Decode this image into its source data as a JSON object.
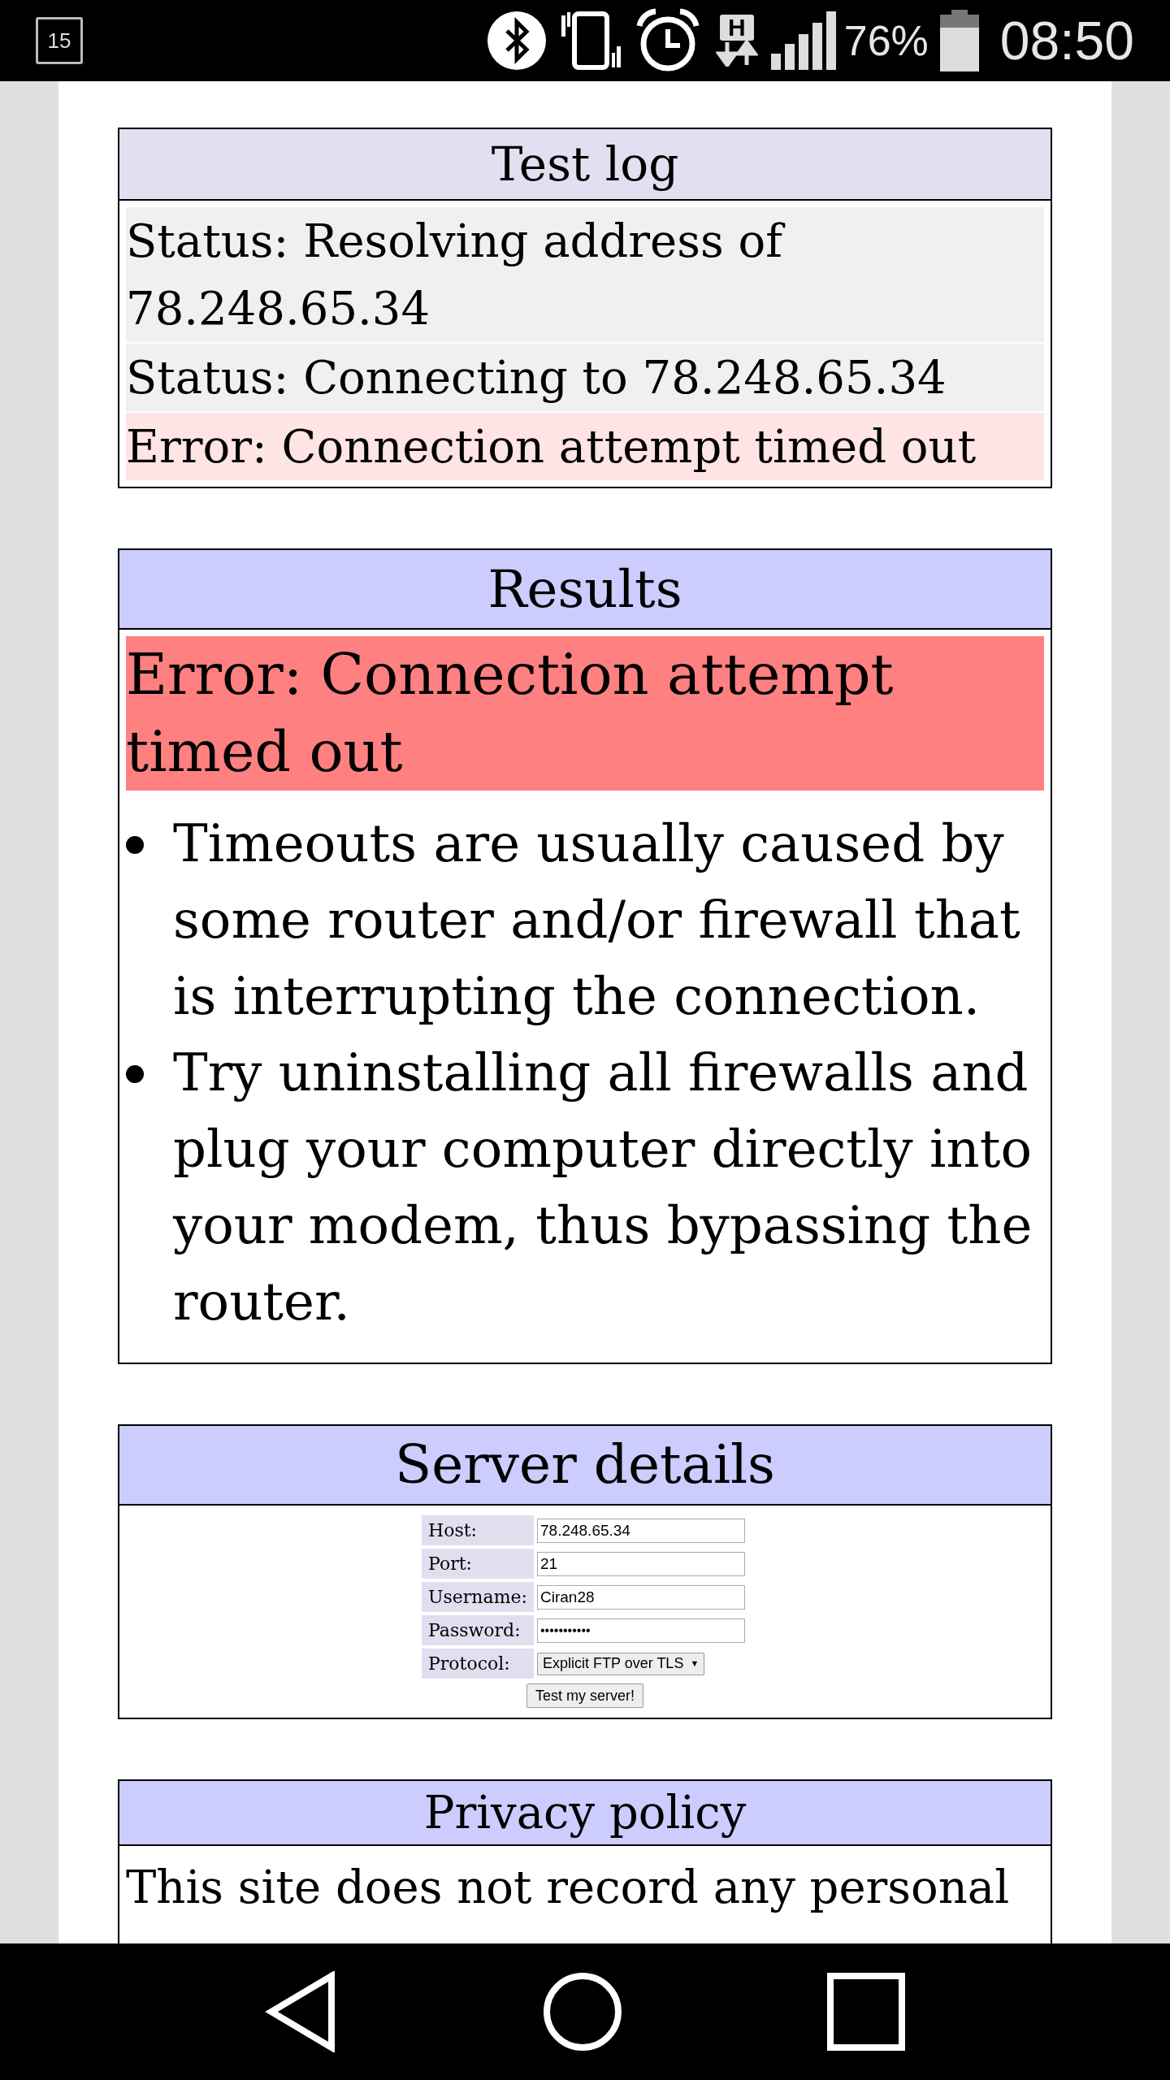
{
  "status_bar": {
    "calendar_day": "15",
    "network_type": "H",
    "battery": "76%",
    "time": "08:50"
  },
  "test_log": {
    "title": "Test log",
    "entries": [
      {
        "kind": "status",
        "text": "Status: Resolving address of 78.248.65.34"
      },
      {
        "kind": "status",
        "text": "Status: Connecting to 78.248.65.34"
      },
      {
        "kind": "error",
        "text": "Error: Connection attempt timed out"
      }
    ]
  },
  "results": {
    "title": "Results",
    "error": "Error: Connection attempt timed out",
    "tips": [
      "Timeouts are usually caused by some router and/or firewall that is interrupting the connection.",
      "Try uninstalling all firewalls and plug your computer directly into your modem, thus bypassing the router."
    ]
  },
  "server_details": {
    "title": "Server details",
    "fields": [
      {
        "kind": "text",
        "label": "Host:",
        "value": "78.248.65.34"
      },
      {
        "kind": "text",
        "label": "Port:",
        "value": "21"
      },
      {
        "kind": "text",
        "label": "Username:",
        "value": "Ciran28"
      },
      {
        "kind": "password",
        "label": "Password:",
        "value": "•••••••••••"
      },
      {
        "kind": "select",
        "label": "Protocol:",
        "value": "Explicit FTP over TLS",
        "arrow": "▼"
      }
    ],
    "button": "Test my server!"
  },
  "privacy_policy": {
    "title": "Privacy policy",
    "text": "This site does not record any personal"
  }
}
